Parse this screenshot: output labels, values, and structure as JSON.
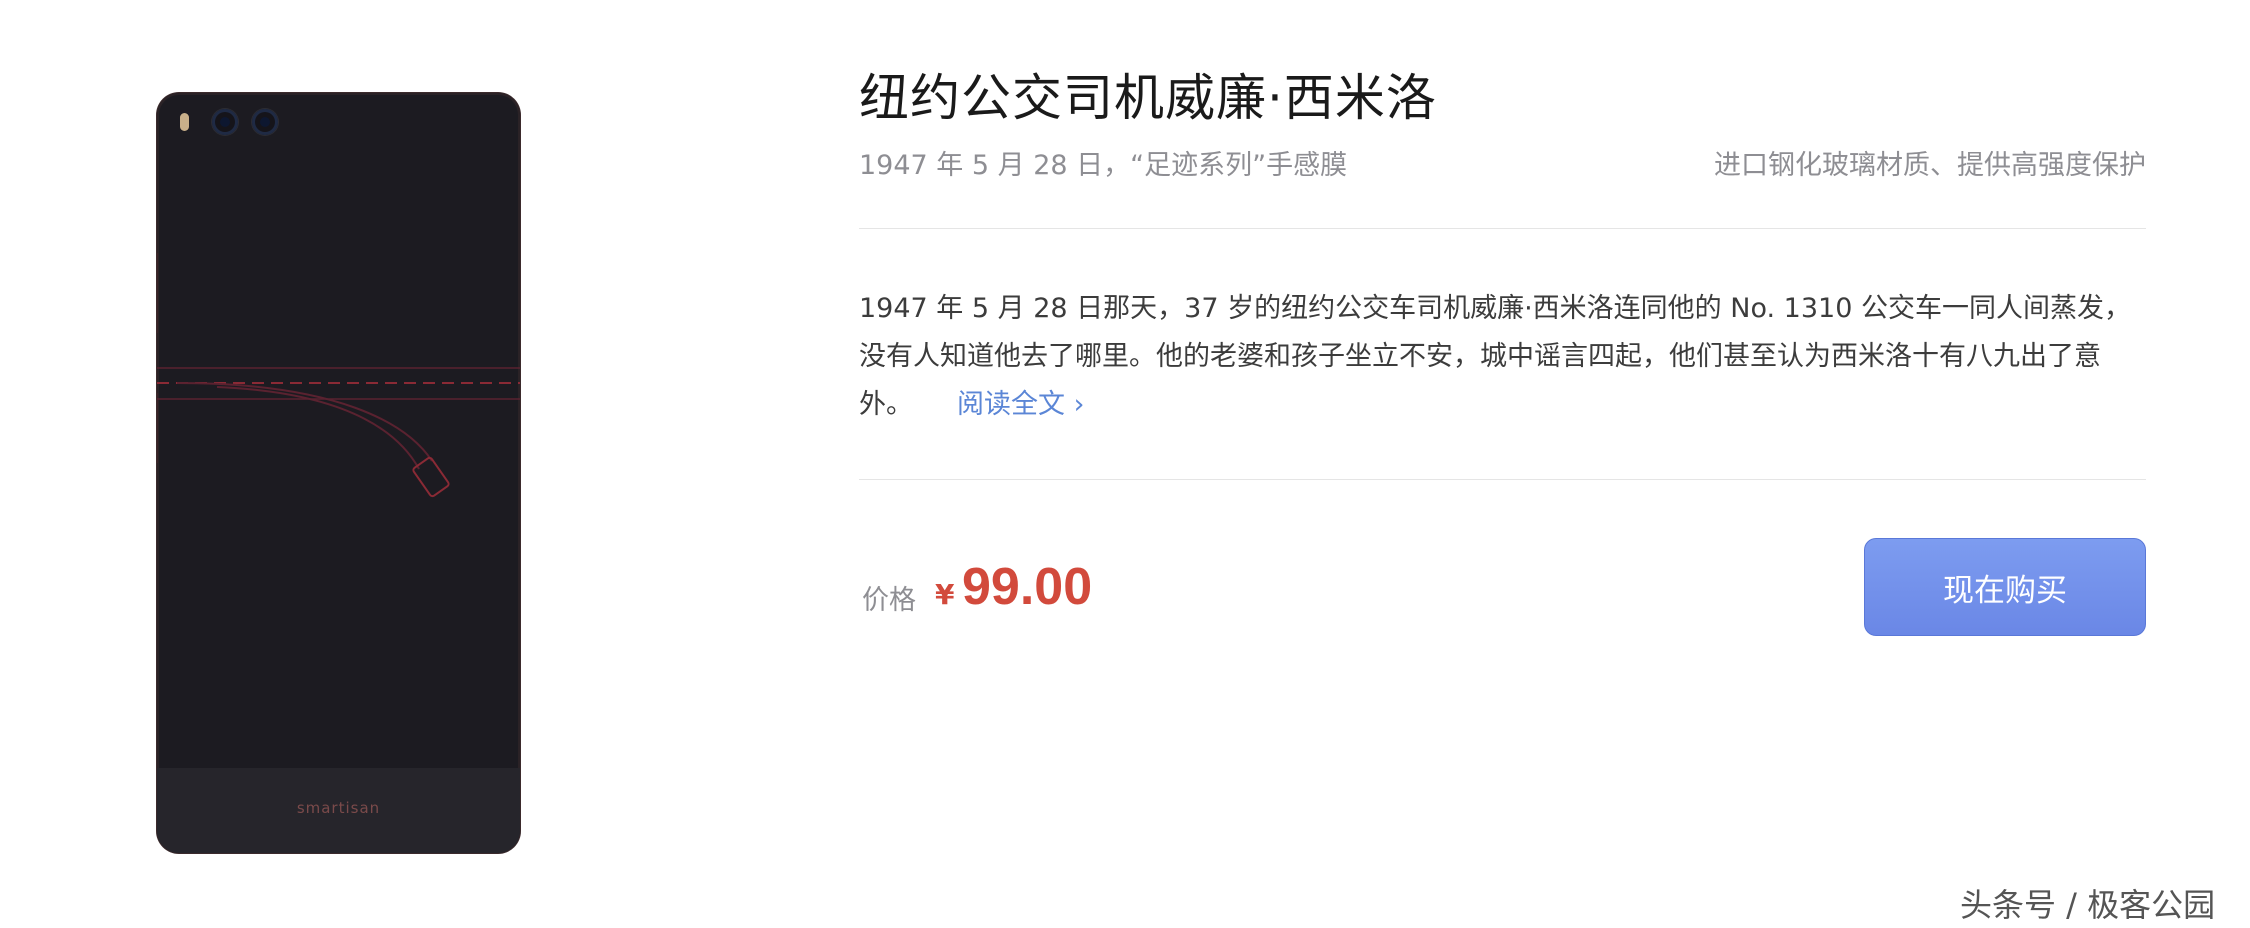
{
  "product": {
    "title": "纽约公交司机威廉·西米洛",
    "subtitle": "1947 年 5 月 28 日，“足迹系列”手感膜",
    "feature": "进口钢化玻璃材质、提供高强度保护",
    "description": "1947 年 5 月 28 日那天，37 岁的纽约公交车司机威廉·西米洛连同他的 No. 1310 公交车一同人间蒸发，没有人知道他去了哪里。他的老婆和孩子坐立不安，城中谣言四起，他们甚至认为西米洛十有八九出了意外。",
    "read_more": "阅读全文 ›",
    "price_label": "价格",
    "currency": "¥",
    "price": "99.00",
    "buy_label": "现在购买",
    "phone_brand": "smartisan"
  },
  "watermark": "头条号 / 极客公园",
  "colors": {
    "price": "#d24a3c",
    "link": "#5b86d6",
    "button": "#6a87e6",
    "phone_body": "#1c1b21",
    "film_accent": "#8a2a35"
  }
}
